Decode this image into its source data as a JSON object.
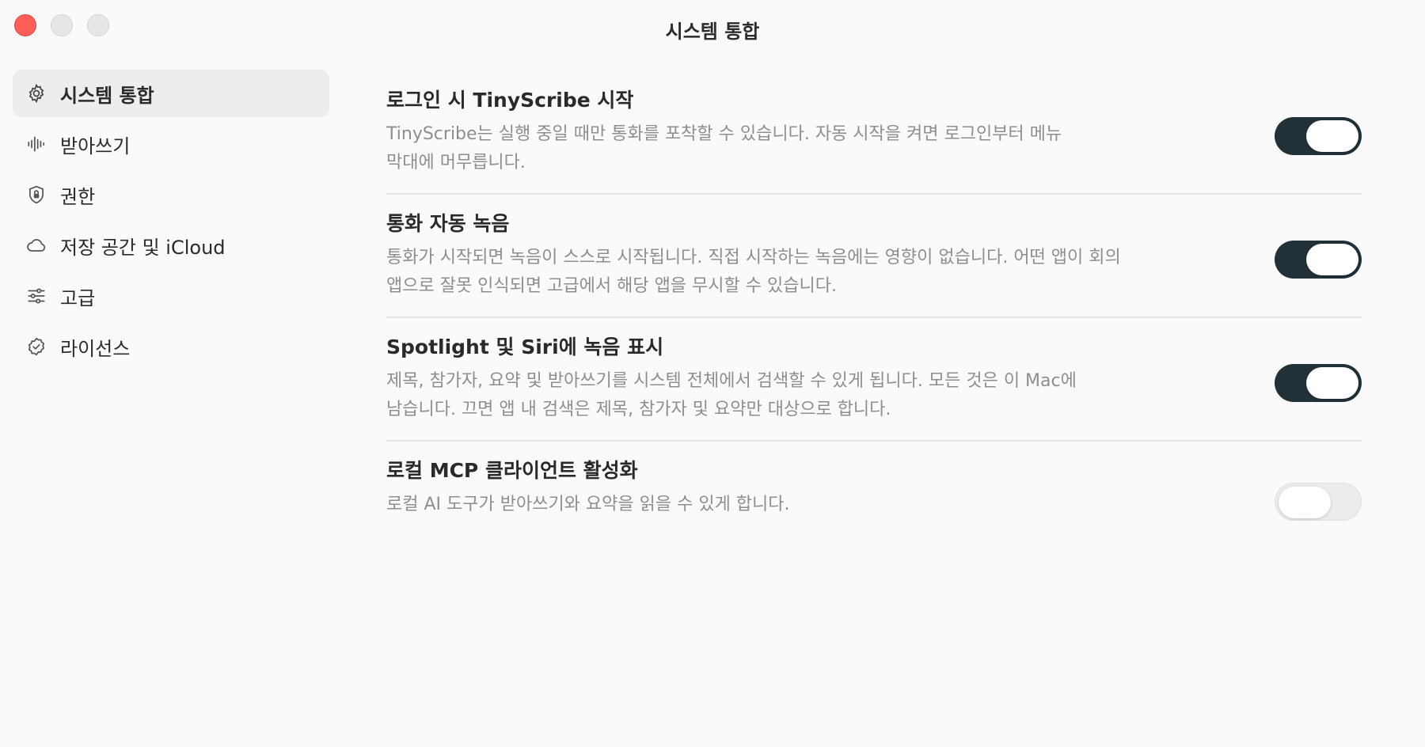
{
  "window": {
    "title": "시스템 통합"
  },
  "sidebar": {
    "items": [
      {
        "label": "시스템 통합",
        "icon": "gear-icon",
        "active": true
      },
      {
        "label": "받아쓰기",
        "icon": "waveform-icon",
        "active": false
      },
      {
        "label": "권한",
        "icon": "shield-lock-icon",
        "active": false
      },
      {
        "label": "저장 공간 및 iCloud",
        "icon": "cloud-icon",
        "active": false
      },
      {
        "label": "고급",
        "icon": "sliders-icon",
        "active": false
      },
      {
        "label": "라이선스",
        "icon": "seal-check-icon",
        "active": false
      }
    ]
  },
  "settings": [
    {
      "title": "로그인 시 TinyScribe 시작",
      "desc1": "TinyScribe는 실행 중일 때만 통화를 포착할 수 있습니다. 자동 시작을 켜면 로그인부터 메뉴",
      "desc2": "막대에 머무릅니다.",
      "enabled": true
    },
    {
      "title": "통화 자동 녹음",
      "desc1": "통화가 시작되면 녹음이 스스로 시작됩니다. 직접 시작하는 녹음에는 영향이 없습니다. 어떤 앱이 회의",
      "desc2": "앱으로 잘못 인식되면 고급에서 해당 앱을 무시할 수 있습니다.",
      "enabled": true
    },
    {
      "title": "Spotlight 및 Siri에 녹음 표시",
      "desc1": "제목, 참가자, 요약 및 받아쓰기를 시스템 전체에서 검색할 수 있게 됩니다. 모든 것은 이 Mac에",
      "desc2": "남습니다. 끄면 앱 내 검색은 제목, 참가자 및 요약만 대상으로 합니다.",
      "enabled": true
    },
    {
      "title": "로컬 MCP 클라이언트 활성화",
      "desc1": "로컬 AI 도구가 받아쓰기와 요약을 읽을 수 있게 합니다.",
      "desc2": "",
      "enabled": false
    }
  ],
  "colors": {
    "toggle_on": "#223038",
    "toggle_off": "#ececec",
    "close_button": "#ff5f57"
  }
}
